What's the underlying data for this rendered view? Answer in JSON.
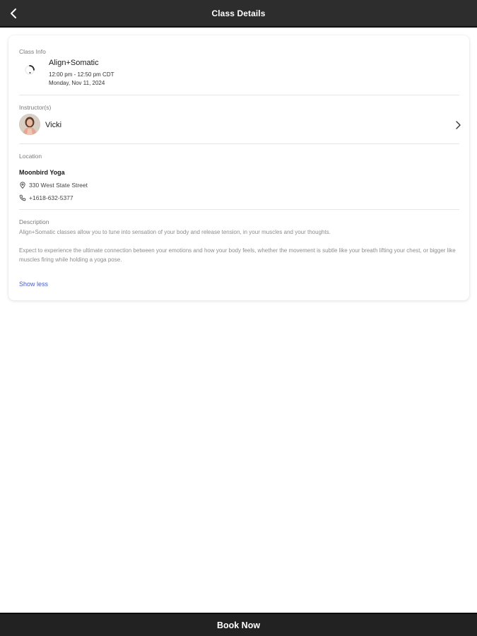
{
  "header": {
    "title": "Class Details",
    "back_icon": "chevron-left-icon"
  },
  "class_info": {
    "label": "Class Info",
    "name": "Align+Somatic",
    "time": "12:00 pm - 12:50 pm CDT",
    "date": "Monday, Nov 11, 2024",
    "icon": "loading-spinner-icon"
  },
  "instructors": {
    "label": "Instructor(s)",
    "name": "Vicki",
    "arrow_icon": "chevron-right-icon"
  },
  "location": {
    "label": "Location",
    "name": "Moonbird Yoga",
    "address": "330 West State Street",
    "address_icon": "map-pin-icon",
    "phone": "+1618-632-5377",
    "phone_icon": "phone-icon"
  },
  "description": {
    "label": "Description",
    "paragraph_1": "Align+Somatic classes allow you to tune into sensation of your body and release tension, in your muscles and your thoughts.",
    "paragraph_2": "Expect to experience the ultimate connection between your emotions and how your body feels, whether the movement is subtle like your breath lifting your chest, or bigger like muscles firing while holding a yoga pose.",
    "toggle_label": "Show less"
  },
  "footer": {
    "button_label": "Book Now"
  },
  "colors": {
    "header_bg": "#2d2d2d",
    "footer_bg": "#222222",
    "link": "#4a5dc4",
    "muted_text": "#8c8c8c"
  }
}
